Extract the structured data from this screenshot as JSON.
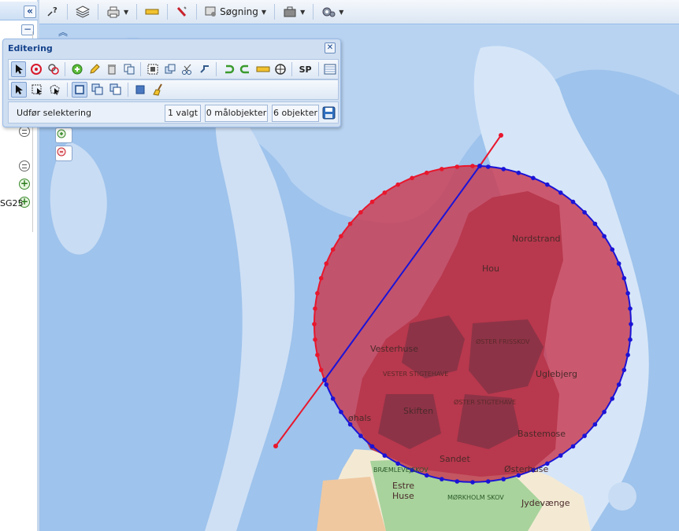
{
  "left_panel": {
    "collapse_label": "«",
    "minus_label": "−",
    "layer_label": "SG25"
  },
  "toolbar": {
    "search_label": "Søgning"
  },
  "editing": {
    "title": "Editering",
    "sp_label": "SP",
    "status_label": "Udfør selektering",
    "selected": "1 valgt",
    "targets": "0 målobjekter",
    "objects": "6 objekter"
  },
  "map": {
    "labels": [
      "Nordstrand",
      "Hou",
      "Vesterhuse",
      "ØSTER FRISSKOV",
      "Uglebjerg",
      "VESTER STIGTEHAVE",
      "ØSTER STIGTEHAVE",
      "Skiften",
      "øhals",
      "Bastemose",
      "Sandet",
      "Østerhuse",
      "BRÆMLEVEJSKOV",
      "Estre",
      "Huse",
      "MØRKHOLM SKOV",
      "Jydevænge"
    ],
    "colors": {
      "sea": "#9ec3ec",
      "shallow": "#cfe0f5",
      "buffer_fill": "#c84057",
      "red_line": "#e8172d",
      "blue_line": "#1b13d6"
    }
  }
}
